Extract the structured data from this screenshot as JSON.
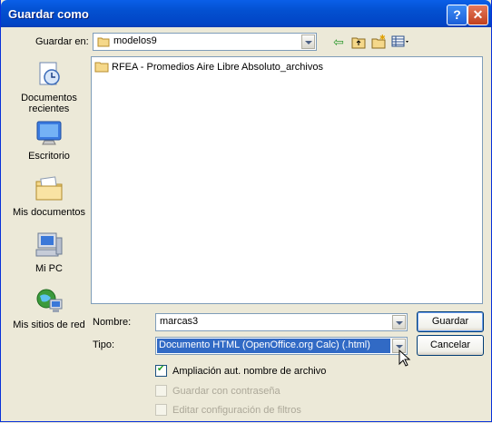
{
  "window": {
    "title": "Guardar como"
  },
  "toolbar": {
    "save_in_label": "Guardar en:",
    "save_in_value": "modelos9"
  },
  "places": [
    {
      "label": "Documentos recientes",
      "icon": "recent-documents-icon"
    },
    {
      "label": "Escritorio",
      "icon": "desktop-icon"
    },
    {
      "label": "Mis documentos",
      "icon": "my-documents-icon"
    },
    {
      "label": "Mi PC",
      "icon": "my-computer-icon"
    },
    {
      "label": "Mis sitios de red",
      "icon": "network-places-icon"
    }
  ],
  "files": [
    {
      "name": "RFEA - Promedios Aire Libre Absoluto_archivos",
      "icon": "folder-icon"
    }
  ],
  "form": {
    "name_label": "Nombre:",
    "name_value": "marcas3",
    "type_label": "Tipo:",
    "type_value": "Documento HTML (OpenOffice.org Calc) (.html)"
  },
  "buttons": {
    "save": "Guardar",
    "cancel": "Cancelar"
  },
  "options": {
    "auto_ext": "Ampliación aut. nombre de archivo",
    "password": "Guardar con contraseña",
    "filter": "Editar configuración de filtros"
  },
  "colors": {
    "title_bar": "#0A5FE8",
    "selection": "#316AC5",
    "dialog_bg": "#ECE9D8"
  }
}
